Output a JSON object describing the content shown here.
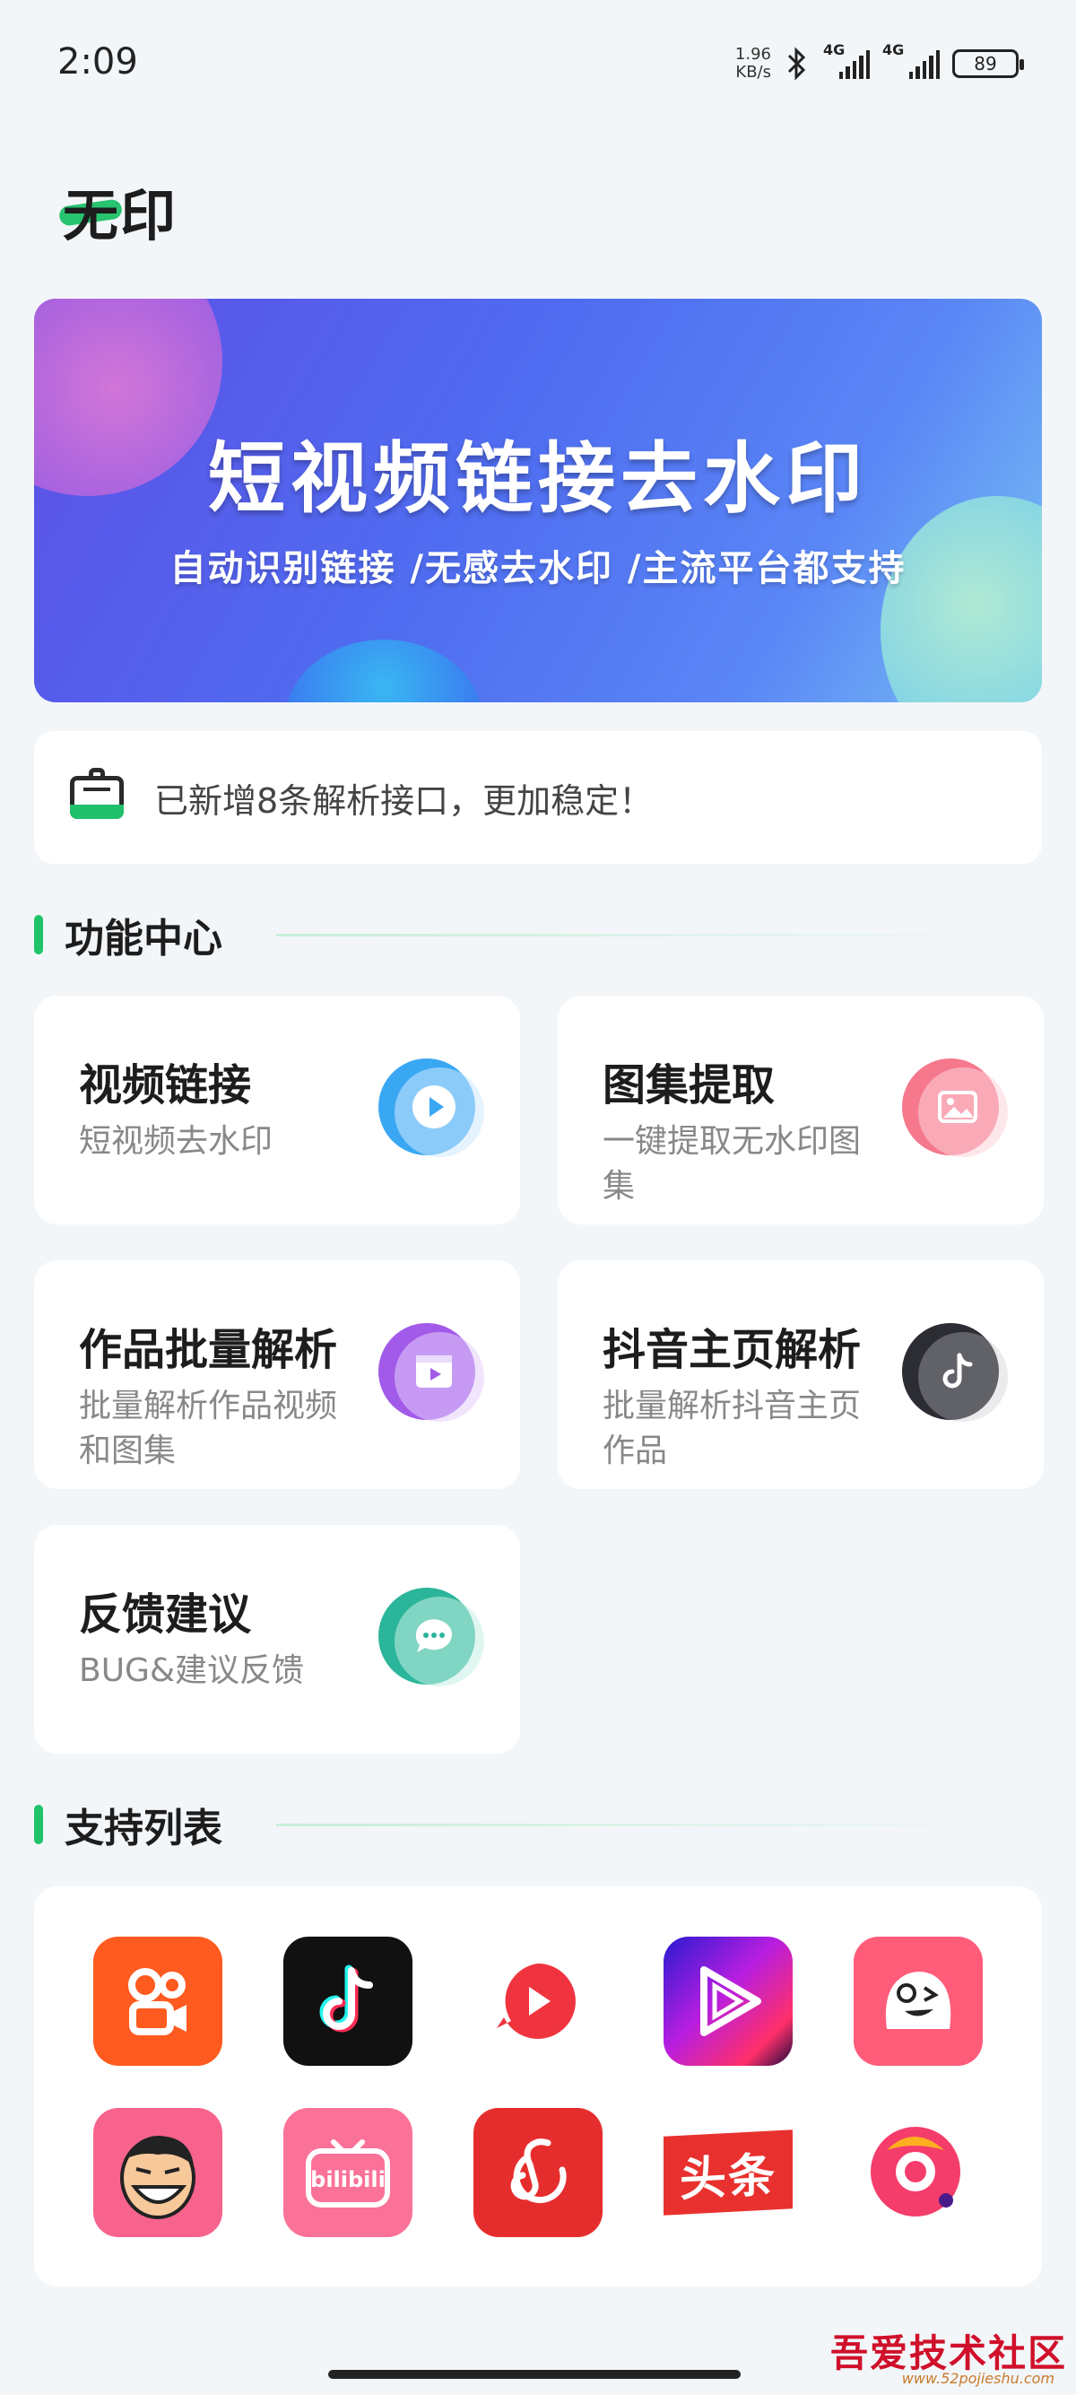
{
  "status_bar": {
    "time": "2:09",
    "net_speed_value": "1.96",
    "net_speed_unit": "KB/s",
    "signal1_label": "4G",
    "signal2_label": "4G",
    "battery": "89"
  },
  "app": {
    "title": "无印"
  },
  "banner": {
    "title": "短视频链接去水印",
    "subtitle": "自动识别链接 /无感去水印 /主流平台都支持"
  },
  "notice": {
    "text": "已新增8条解析接口，更加稳定！"
  },
  "sections": {
    "functions_title": "功能中心",
    "platforms_title": "支持列表"
  },
  "functions": [
    {
      "title": "视频链接",
      "desc": "短视频去水印",
      "icon": "play-icon",
      "color": "#3aa7f3"
    },
    {
      "title": "图集提取",
      "desc": "一键提取无水印图集",
      "icon": "image-icon",
      "color": "#f6788d"
    },
    {
      "title": "作品批量解析",
      "desc": "批量解析作品视频和图集",
      "icon": "video-clip-icon",
      "color": "#a25ae8"
    },
    {
      "title": "抖音主页解析",
      "desc": "批量解析抖音主页作品",
      "icon": "douyin-icon",
      "color": "#2c2c33"
    },
    {
      "title": "反馈建议",
      "desc": "BUG&建议反馈",
      "icon": "chat-bubble-icon",
      "color": "#2bb59a"
    }
  ],
  "platforms": [
    {
      "name": "kuaishou",
      "icon": "kuaishou-logo-icon",
      "color": "#ff5a1f"
    },
    {
      "name": "douyin",
      "icon": "douyin-logo-icon",
      "color": "#111111"
    },
    {
      "name": "weishi",
      "icon": "weishi-logo-icon",
      "color": "#f0343f"
    },
    {
      "name": "huoshan",
      "icon": "play-triangle-logo-icon",
      "color": "#7b2ff0"
    },
    {
      "name": "pipixia",
      "icon": "pipixia-logo-icon",
      "color": "#ff5c7a"
    },
    {
      "name": "zuiyou",
      "icon": "laughing-face-logo-icon",
      "color": "#f7638c"
    },
    {
      "name": "bilibili",
      "icon": "bilibili-logo-icon",
      "color": "#fb7299"
    },
    {
      "name": "netease-music",
      "icon": "netease-music-logo-icon",
      "color": "#e62d2d"
    },
    {
      "name": "toutiao",
      "icon": "toutiao-logo-icon",
      "color": "#e8312e",
      "label": "头条"
    },
    {
      "name": "meipai",
      "icon": "meipai-logo-icon",
      "color": "#f43d6b"
    }
  ],
  "watermark": {
    "text": "吾爱技术社区",
    "url": "www.52pojieshu.com"
  },
  "colors": {
    "accent": "#1fc46a",
    "background": "#f3f6f9"
  }
}
